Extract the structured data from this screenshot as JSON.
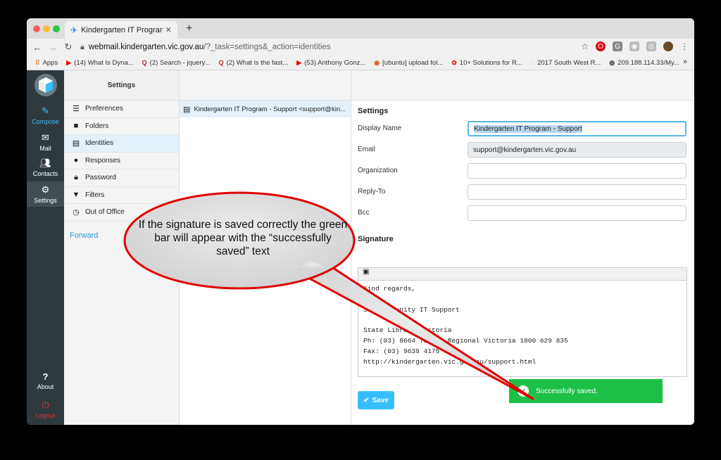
{
  "browser": {
    "tab_title": "Kindergarten IT Program Webma",
    "url_host": "webmail.kindergarten.vic.gov.au",
    "url_path": "/?_task=settings&_action=identities",
    "bookmarks": [
      {
        "icon": "apps-grid-icon",
        "label": "Apps"
      },
      {
        "icon": "youtube-icon",
        "label": "(14) What Is Dyna..."
      },
      {
        "icon": "quora-icon",
        "label": "(2) Search - jquery..."
      },
      {
        "icon": "quora-icon",
        "label": "(2) What is the fast..."
      },
      {
        "icon": "youtube-icon",
        "label": "(53) Anthony Gonz..."
      },
      {
        "icon": "ubuntu-icon",
        "label": "[ubuntu] upload fol..."
      },
      {
        "icon": "huawei-icon",
        "label": "10+ Solutions for R..."
      },
      {
        "icon": "loader-icon",
        "label": "2017 South West R..."
      },
      {
        "icon": "globe-icon",
        "label": "209.188.114.33/My..."
      }
    ],
    "bookmarks_more": "»"
  },
  "rail": {
    "compose": "Compose",
    "mail": "Mail",
    "contacts": "Contacts",
    "settings": "Settings",
    "about": "About",
    "logout": "Logout"
  },
  "settings_col": {
    "header": "Settings",
    "items": [
      {
        "icon": "sliders-icon",
        "label": "Preferences"
      },
      {
        "icon": "folder-icon",
        "label": "Folders"
      },
      {
        "icon": "id-card-icon",
        "label": "Identities"
      },
      {
        "icon": "comment-icon",
        "label": "Responses"
      },
      {
        "icon": "lock-icon",
        "label": "Password"
      },
      {
        "icon": "filter-icon",
        "label": "Filters"
      },
      {
        "icon": "clock-icon",
        "label": "Out of Office"
      }
    ],
    "forward": "Forward"
  },
  "identities": {
    "item": "Kindergarten IT Program - Support <support@kin..."
  },
  "form": {
    "section_title": "Settings",
    "display_name_label": "Display Name",
    "display_name_value": "Kindergarten IT Program - Support",
    "email_label": "Email",
    "email_value": "support@kindergarten.vic.gov.au",
    "organization_label": "Organization",
    "replyto_label": "Reply-To",
    "bcc_label": "Bcc",
    "signature_title": "Signature",
    "signature_text": "Kind regards,\n\nSLV Community IT Support\n\nState Library Victoria\nPh: (03) 8664 7001 - Regional Victoria 1800 629 835\nFax: (03) 9639 4175\nhttp://kindergarten.vic.gov.au/support.html",
    "save_label": "Save"
  },
  "toast": {
    "message": "Successfully saved."
  },
  "annotation": {
    "text": "If the signature is saved correctly the green bar will appear with the “successfully saved” text"
  }
}
